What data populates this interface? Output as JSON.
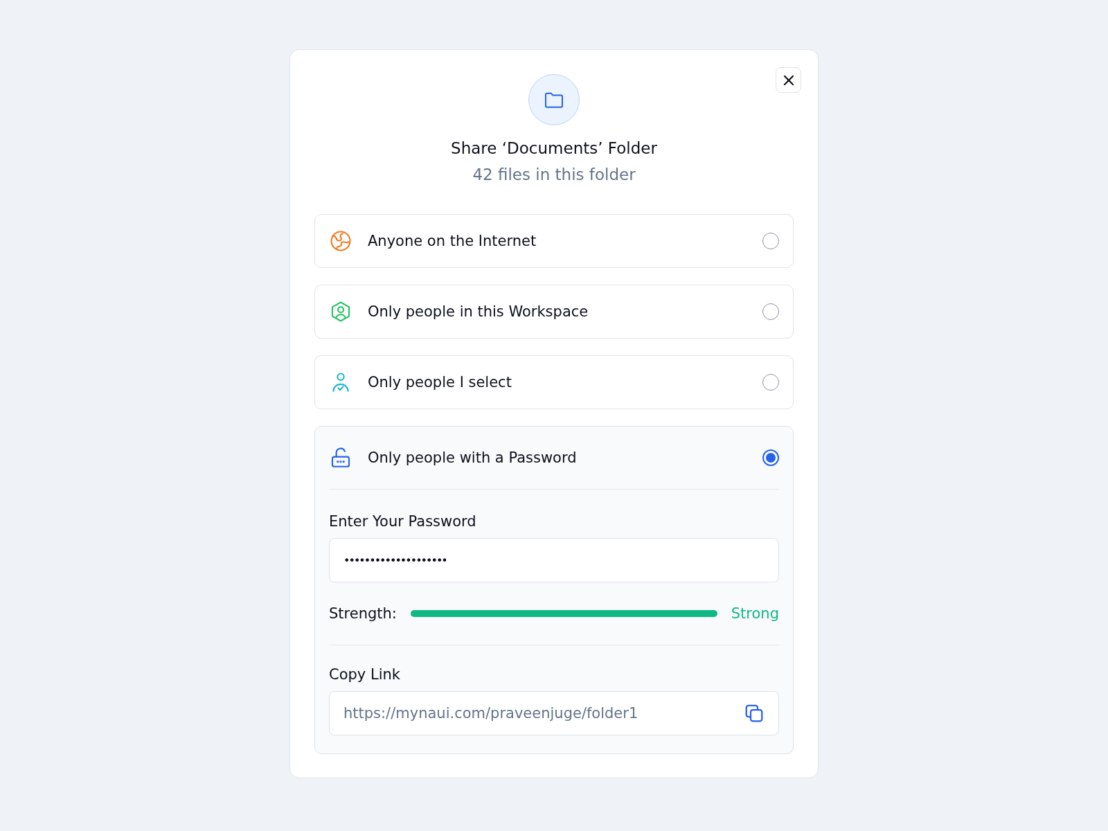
{
  "dialog": {
    "title": "Share ‘Documents’ Folder",
    "subtitle": "42 files in this folder"
  },
  "options": [
    {
      "kind": "globe",
      "label": "Anyone on the Internet",
      "color": "#f07a1f",
      "selected": false
    },
    {
      "kind": "workspace",
      "label": "Only people in this Workspace",
      "color": "#22c55e",
      "selected": false
    },
    {
      "kind": "person",
      "label": "Only people I select",
      "color": "#1fb5d6",
      "selected": false
    },
    {
      "kind": "lock",
      "label": "Only people with a Password",
      "color": "#2563eb",
      "selected": true,
      "details": {
        "password_label": "Enter Your Password",
        "password_value": "••••••••••••••••••••",
        "strength_label": "Strength:",
        "strength": {
          "level": 1,
          "reading": "Strong"
        },
        "link_label": "Copy Link",
        "link_value": "https://mynaui.com/praveenjuge/folder1"
      }
    }
  ]
}
